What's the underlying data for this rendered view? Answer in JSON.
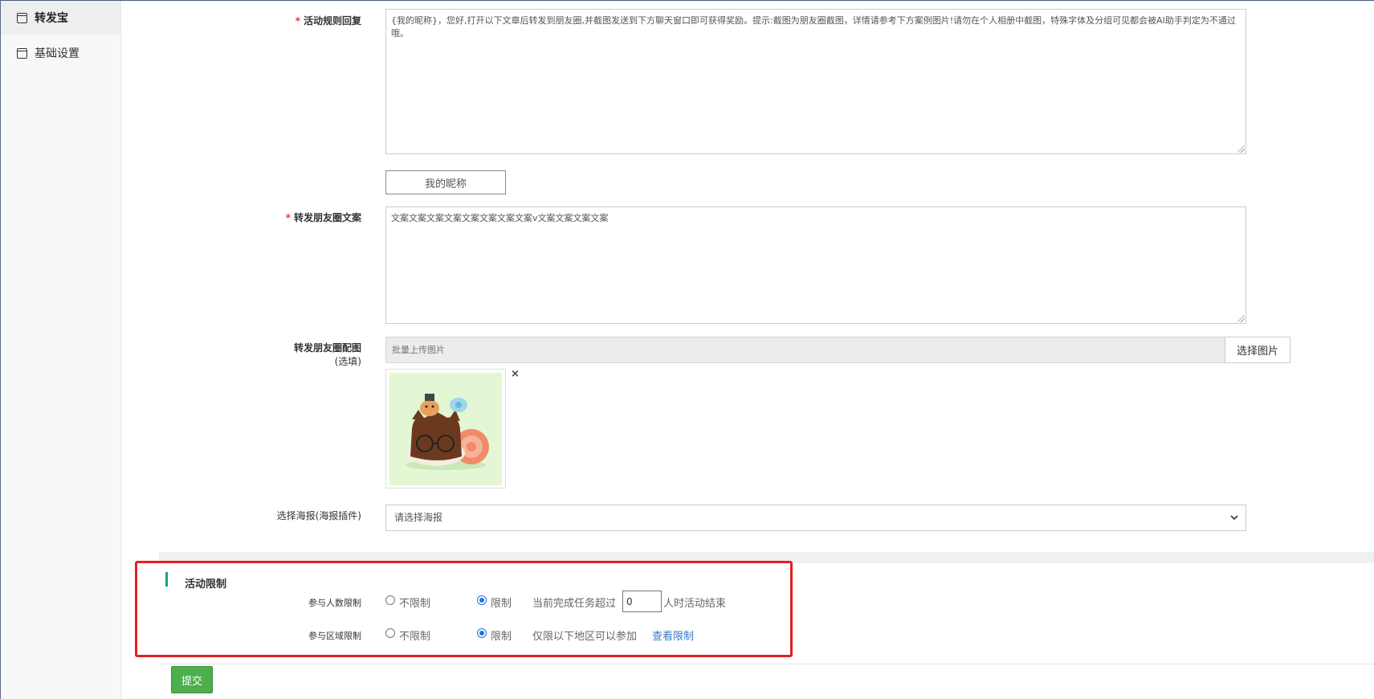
{
  "sidebar": {
    "items": [
      {
        "label": "转发宝",
        "active": true
      },
      {
        "label": "基础设置",
        "active": false
      }
    ]
  },
  "form": {
    "rule_reply": {
      "label": "活动规则回复",
      "value": "{我的昵称}，您好,打开以下文章后转发到朋友圈,并截图发送到下方聊天窗口即可获得奖励。提示:截图为朋友圈截图，详情请参考下方案例图片!请勿在个人相册中截图，特殊字体及分组可见都会被AI助手判定为不通过哦。"
    },
    "nickname_button": "我的昵称",
    "moments_copy": {
      "label": "转发朋友圈文案",
      "value": "文案文案文案文案文案文案文案文案v文案文案文案文案"
    },
    "moments_image": {
      "label": "转发朋友圈配图",
      "label_note": "(选填)",
      "placeholder": "批量上传图片",
      "button": "选择图片",
      "remove": "×"
    },
    "poster": {
      "label": "选择海报(海报插件)",
      "placeholder": "请选择海报"
    }
  },
  "limits": {
    "title": "活动限制",
    "participant": {
      "label": "参与人数限制",
      "option_unlimited": "不限制",
      "option_limited": "限制",
      "selected": "limited",
      "desc_before": "当前完成任务超过",
      "value": "0",
      "desc_after": "人时活动结束"
    },
    "region": {
      "label": "参与区域限制",
      "option_unlimited": "不限制",
      "option_limited": "限制",
      "selected": "limited",
      "desc": "仅限以下地区可以参加",
      "link": "查看限制"
    }
  },
  "submit_label": "提交",
  "colors": {
    "accent_green": "#4cae4c",
    "section_bar": "#1aa087",
    "highlight_red": "#e32020",
    "link_blue": "#3a75c4"
  }
}
